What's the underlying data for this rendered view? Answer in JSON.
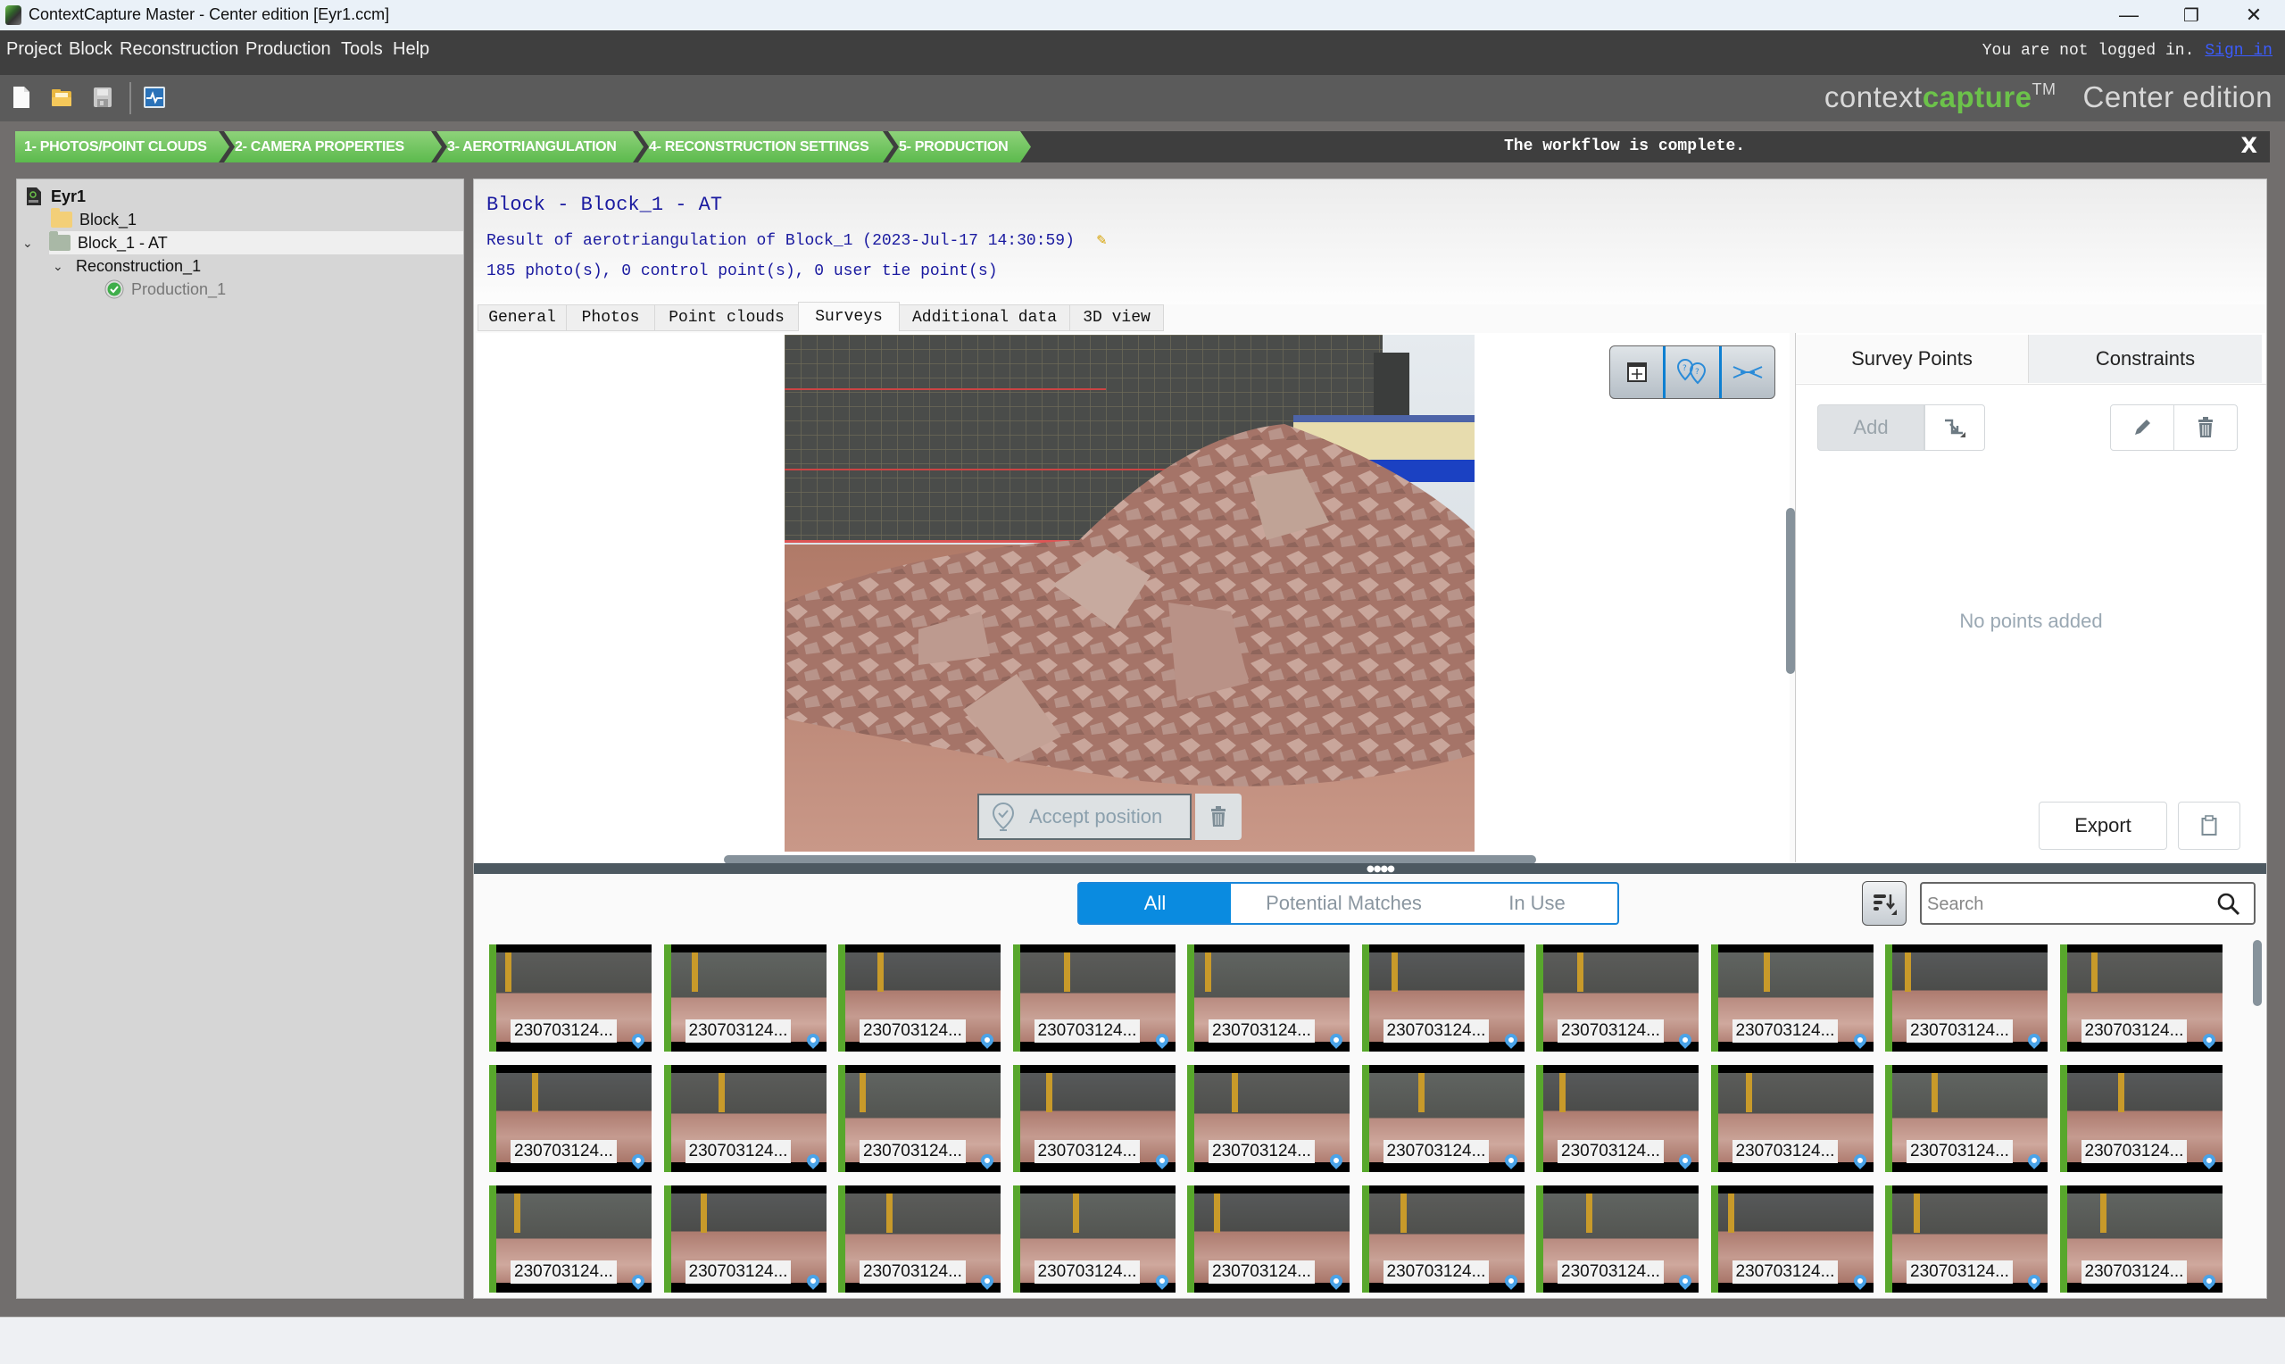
{
  "window": {
    "title": "ContextCapture Master - Center edition [Eyr1.ccm]",
    "controls": {
      "minimize": "—",
      "restore": "❐",
      "close": "✕"
    }
  },
  "menubar": {
    "items": [
      "Project",
      "Block",
      "Reconstruction",
      "Production",
      "Tools",
      "Help"
    ],
    "login_text": "You are not logged in.",
    "sign_in": "Sign in"
  },
  "toolbar": {
    "icons": [
      "new-project-icon",
      "open-project-icon",
      "save-project-icon",
      "job-monitor-icon"
    ]
  },
  "brand": {
    "prefix": "context",
    "highlight": "capture",
    "tm": "TM",
    "edition": "Center edition",
    "accent": "#6cc24a"
  },
  "workflow": {
    "steps": [
      "1- PHOTOS/POINT CLOUDS",
      "2- CAMERA PROPERTIES",
      "3- AEROTRIANGULATION",
      "4- RECONSTRUCTION SETTINGS",
      "5- PRODUCTION"
    ],
    "message": "The workflow is complete.",
    "close": "X",
    "step_color": "#6cc660"
  },
  "tree": {
    "root": "Eyr1",
    "items": [
      {
        "label": "Block_1",
        "icon": "folder-icon"
      },
      {
        "label": "Block_1 - AT",
        "icon": "folder-icon",
        "expanded": true,
        "selected": true
      },
      {
        "label": "Reconstruction_1",
        "expanded": true
      },
      {
        "label": "Production_1",
        "icon": "check-circle-icon",
        "status": "complete"
      }
    ]
  },
  "header": {
    "title": "Block - Block_1 - AT",
    "description": "Result of aerotriangulation of Block_1 (2023-Jul-17 14:30:59)",
    "stats": "185 photo(s), 0 control point(s), 0 user tie point(s)"
  },
  "tabs": {
    "items": [
      "General",
      "Photos",
      "Point clouds",
      "Surveys",
      "Additional data",
      "3D view"
    ],
    "active": "Surveys"
  },
  "viewer": {
    "tools": [
      "fit-view-icon",
      "potential-matches-icon",
      "tie-point-icon"
    ],
    "accept_label": "Accept position"
  },
  "survey_panel": {
    "tabs": [
      "Survey Points",
      "Constraints"
    ],
    "active_tab": "Survey Points",
    "add_label": "Add",
    "empty_text": "No points added",
    "export_label": "Export"
  },
  "photo_filter": {
    "segments": [
      "All",
      "Potential Matches",
      "In Use"
    ],
    "active": "All",
    "search_placeholder": "Search",
    "accent": "#0a8be0"
  },
  "thumbnails": {
    "label": "230703124...",
    "rows": 3,
    "cols": 10
  }
}
